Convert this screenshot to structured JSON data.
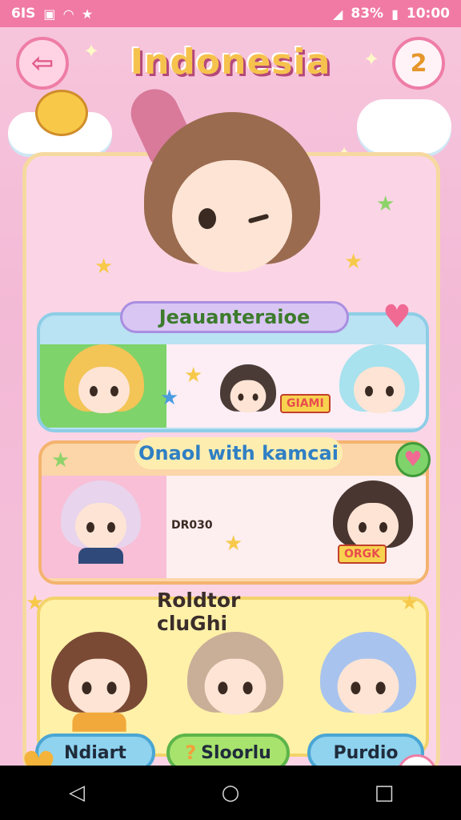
{
  "status_bar": {
    "left_text": "6IS",
    "battery": "83%",
    "time": "10:00",
    "icons": [
      "sim-icon",
      "wifi-icon",
      "star-icon",
      "signal-icon",
      "battery-icon"
    ]
  },
  "header": {
    "title": "Indonesia",
    "back_icon": "arrow-left-icon",
    "badge_value": "2"
  },
  "sections": [
    {
      "banner": "Jeauanteraioe",
      "labels": [
        "GIAMI"
      ],
      "colors": {
        "bg": "#b9e2f3",
        "border": "#8ecde6"
      }
    },
    {
      "banner": "Onaol with kamcai",
      "labels": [
        "DR030",
        "ORGK"
      ],
      "colors": {
        "bg": "#fcd6a8",
        "border": "#f4b36e"
      }
    },
    {
      "banner": "Roldtor cluGhi",
      "labels": [],
      "colors": {
        "bg": "#fff1a8",
        "border": "#f3d36a"
      }
    }
  ],
  "tabs": [
    {
      "label": "Ndiart",
      "icon": ""
    },
    {
      "label": "Sloorlu",
      "icon": "question-icon"
    },
    {
      "label": "Purdio",
      "icon": ""
    }
  ],
  "nav": {
    "back": "◁",
    "home": "○",
    "recent": "□"
  },
  "accent_colors": {
    "pink": "#f07aa3",
    "title_gold": "#f6c24e",
    "blue": "#8fd3ef",
    "green": "#a8e36e"
  }
}
